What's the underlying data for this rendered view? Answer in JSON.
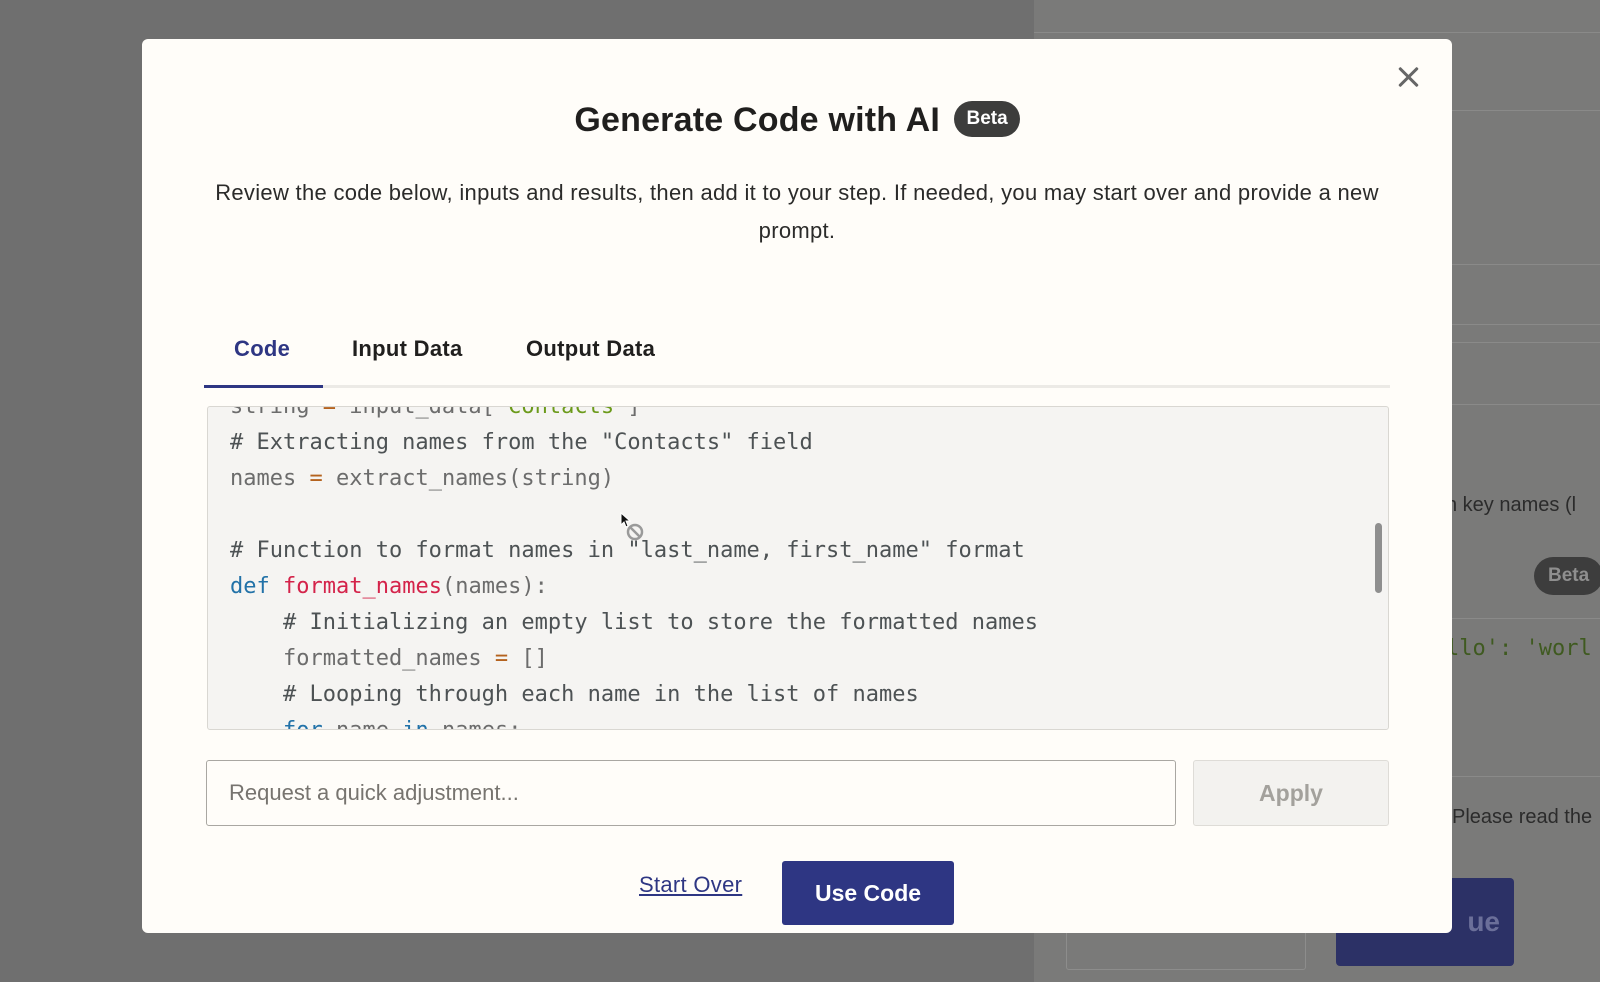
{
  "background": {
    "side_text": "n key names (l",
    "badge": "Beta",
    "code_snippet": "llo': 'worl",
    "notice_text": "Please read the",
    "button_fragment": "ue"
  },
  "modal": {
    "title": "Generate Code with AI",
    "badge": "Beta",
    "description": "Review the code below, inputs and results, then add it to your step. If needed, you may start over and provide a new prompt.",
    "tabs": [
      {
        "label": "Code",
        "active": true
      },
      {
        "label": "Input Data",
        "active": false
      },
      {
        "label": "Output Data",
        "active": false
      }
    ],
    "code_lines": [
      "string = input_data['Contacts']",
      "# Extracting names from the \"Contacts\" field",
      "names = extract_names(string)",
      "",
      "# Function to format names in \"last_name, first_name\" format",
      "def format_names(names):",
      "    # Initializing an empty list to store the formatted names",
      "    formatted_names = []",
      "    # Looping through each name in the list of names",
      "    for name in names:"
    ],
    "adjust_placeholder": "Request a quick adjustment...",
    "apply_label": "Apply",
    "start_over_label": "Start Over",
    "use_code_label": "Use Code"
  },
  "colors": {
    "primary": "#2e3683",
    "modal_bg": "#fffdf9",
    "overlay": "#6f6f6f"
  }
}
